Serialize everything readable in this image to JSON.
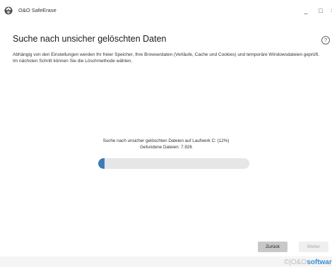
{
  "window": {
    "app_title": "O&O SafeErase",
    "min_glyph": "_",
    "max_glyph": "□",
    "close_glyph": "×"
  },
  "page": {
    "title": "Suche nach unsicher gelöschten Daten",
    "help_glyph": "?",
    "description": "Abhängig von den Einstellungen werden Ihr freier Speicher, Ihre Browserdaten (Verläufe, Cache und Cookies) und temporäre Windowsdateien geprüft. Im nächsten Schritt können Sie die Löschmethode wählen."
  },
  "progress": {
    "status_text": "Suche nach unsicher gelöschten Dateien auf Laufwerk C: (12%)",
    "found_text": "Gefundene Dateien: 7.926",
    "percent": 4,
    "fill_color": "#3d7ab8"
  },
  "buttons": {
    "back_label": "Zurück",
    "next_label": "Weiter"
  },
  "branding": {
    "prefix": "©|O&O",
    "name": "softwar"
  },
  "icons": {
    "app": "oo-safeerase-logo-icon",
    "help": "question-mark-icon"
  }
}
